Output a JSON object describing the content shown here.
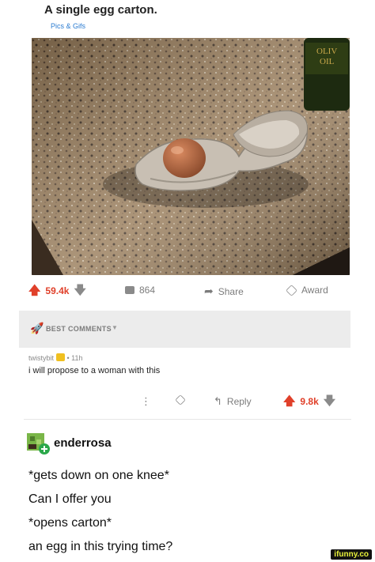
{
  "post": {
    "title": "A single egg carton.",
    "flair": "Pics & Gifs"
  },
  "image": {
    "bottle_label": "OLIV\nOIL",
    "bottle_label_1": "OLIV",
    "bottle_label_2": "OIL"
  },
  "actions": {
    "score": "59.4k",
    "comments": "864",
    "share": "Share",
    "award": "Award"
  },
  "comments_section": {
    "sort_label": "BEST COMMENTS"
  },
  "comment": {
    "username": "twistybit",
    "age": "• 11h",
    "body": "i will propose to a woman with this",
    "reply": "Reply",
    "score": "9.8k"
  },
  "tweet": {
    "author": "enderrosa",
    "lines": [
      "*gets down on one knee*",
      "Can I offer you",
      "*opens carton*",
      "an egg in this trying time?"
    ]
  },
  "watermark": "ifunny.co",
  "colors": {
    "upvote": "#e0402a",
    "flair": "#2a7bd1",
    "best_bar_bg": "#ececec"
  }
}
